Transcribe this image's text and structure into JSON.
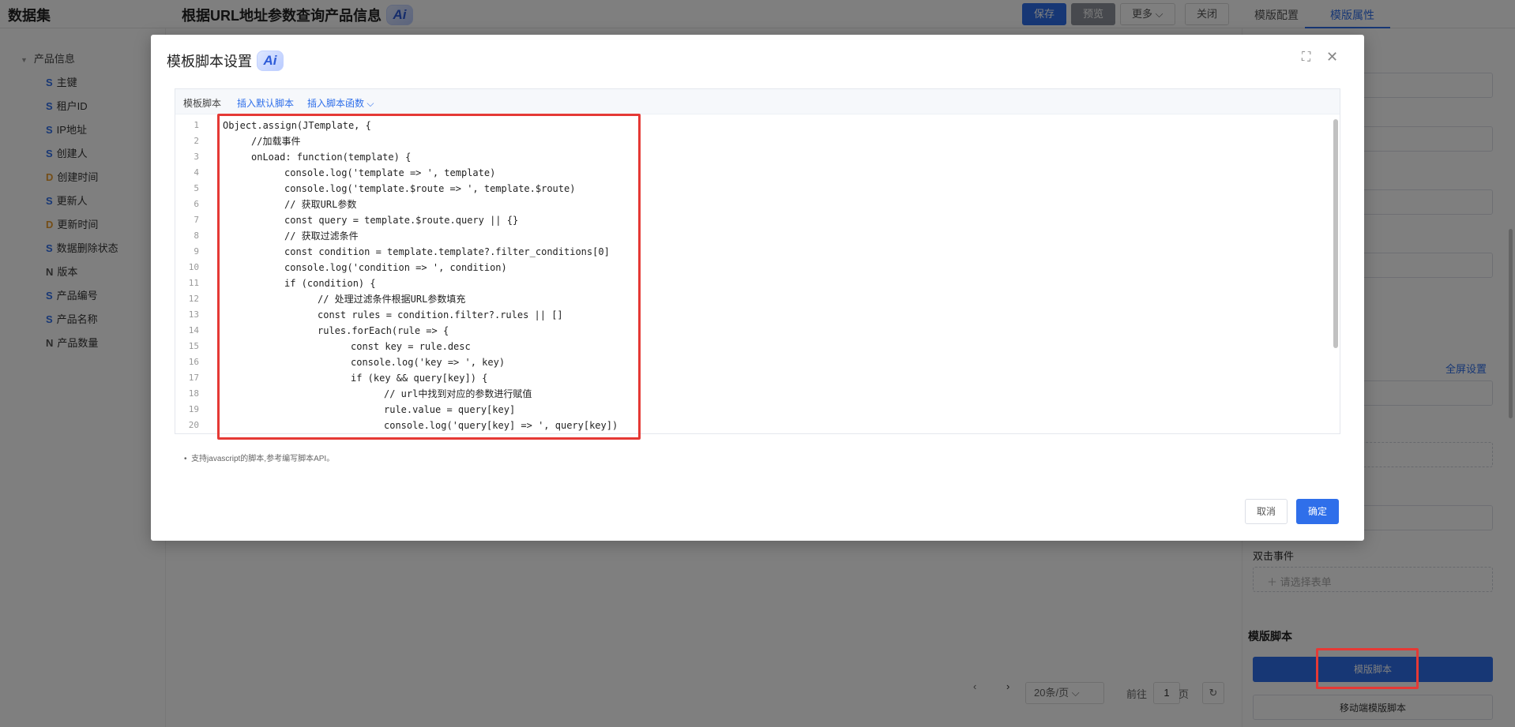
{
  "app": {
    "brand": "数据集",
    "title": "根据URL地址参数查询产品信息",
    "ai_label": "Ai"
  },
  "header_buttons": {
    "save": "保存",
    "preview": "预览",
    "more": "更多",
    "close": "关闭"
  },
  "right_tabs": {
    "config": "模版配置",
    "attrs": "模版属性"
  },
  "tree": {
    "root": "产品信息",
    "items": [
      {
        "type": "S",
        "label": "主键"
      },
      {
        "type": "S",
        "label": "租户ID"
      },
      {
        "type": "S",
        "label": "IP地址"
      },
      {
        "type": "S",
        "label": "创建人"
      },
      {
        "type": "D",
        "label": "创建时间"
      },
      {
        "type": "S",
        "label": "更新人"
      },
      {
        "type": "D",
        "label": "更新时间"
      },
      {
        "type": "S",
        "label": "数据删除状态"
      },
      {
        "type": "N",
        "label": "版本"
      },
      {
        "type": "S",
        "label": "产品编号"
      },
      {
        "type": "S",
        "label": "产品名称"
      },
      {
        "type": "N",
        "label": "产品数量"
      }
    ]
  },
  "pager": {
    "page_size": "20条/页",
    "goto": "前往",
    "page": "1",
    "page_unit": "页"
  },
  "right_panel": {
    "fullscreen_link": "全屏设置",
    "dblclick_label": "双击事件",
    "dblclick_placeholder": "请选择表单",
    "script_section": "模版脚本",
    "script_button": "模版脚本",
    "mobile_script_button": "移动端模版脚本"
  },
  "modal": {
    "title": "模板脚本设置",
    "ai_label": "Ai",
    "toolbar": {
      "label": "模板脚本",
      "insert_default": "插入默认脚本",
      "insert_func": "插入脚本函数"
    },
    "code": [
      {
        "n": "1",
        "indent": 0,
        "text": "Object.assign(JTemplate, {"
      },
      {
        "n": "2",
        "indent": 1,
        "text": "//加载事件"
      },
      {
        "n": "3",
        "indent": 1,
        "text": "onLoad: function(template) {"
      },
      {
        "n": "4",
        "indent": 2,
        "text": "console.log('template => ', template)"
      },
      {
        "n": "5",
        "indent": 2,
        "text": "console.log('template.$route => ', template.$route)"
      },
      {
        "n": "6",
        "indent": 2,
        "text": "// 获取URL参数"
      },
      {
        "n": "7",
        "indent": 2,
        "text": "const query = template.$route.query || {}"
      },
      {
        "n": "8",
        "indent": 2,
        "text": "// 获取过滤条件"
      },
      {
        "n": "9",
        "indent": 2,
        "text": "const condition = template.template?.filter_conditions[0]"
      },
      {
        "n": "10",
        "indent": 2,
        "text": "console.log('condition => ', condition)"
      },
      {
        "n": "11",
        "indent": 2,
        "text": "if (condition) {"
      },
      {
        "n": "12",
        "indent": 3,
        "text": "// 处理过滤条件根据URL参数填充"
      },
      {
        "n": "13",
        "indent": 3,
        "text": "const rules = condition.filter?.rules || []"
      },
      {
        "n": "14",
        "indent": 3,
        "text": "rules.forEach(rule => {"
      },
      {
        "n": "15",
        "indent": 4,
        "text": "const key = rule.desc"
      },
      {
        "n": "16",
        "indent": 4,
        "text": "console.log('key => ', key)"
      },
      {
        "n": "17",
        "indent": 4,
        "text": "if (key && query[key]) {"
      },
      {
        "n": "18",
        "indent": 5,
        "text": "// url中找到对应的参数进行赋值"
      },
      {
        "n": "19",
        "indent": 5,
        "text": "rule.value = query[key]"
      },
      {
        "n": "20",
        "indent": 5,
        "text": "console.log('query[key] => ', query[key])"
      }
    ],
    "hint": "支持javascript的脚本,参考编写脚本API。",
    "cancel": "取消",
    "ok": "确定"
  },
  "colors": {
    "primary": "#2f6fea",
    "highlight": "#e53935"
  },
  "icons": {
    "fullscreen": "fullscreen-icon",
    "close": "close-icon",
    "refresh": "refresh-icon"
  }
}
